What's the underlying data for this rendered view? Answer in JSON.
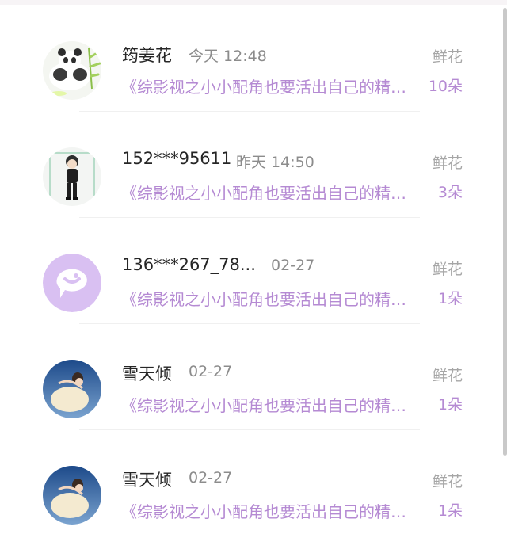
{
  "items": [
    {
      "avatar": "panda-avatar",
      "name": "筠姜花",
      "time": "今天 12:48",
      "book": "《综影视之小小配角也要活出自己的精彩》",
      "gift_type": "鲜花",
      "gift_count": "10朵"
    },
    {
      "avatar": "anime-boy-avatar",
      "name": "152***95611",
      "time": "昨天 14:50",
      "book": "《综影视之小小配角也要活出自己的精彩》",
      "gift_type": "鲜花",
      "gift_count": "3朵"
    },
    {
      "avatar": "default-chat-avatar",
      "name": "136***267_78...",
      "time": "02-27",
      "book": "《综影视之小小配角也要活出自己的精彩》",
      "gift_type": "鲜花",
      "gift_count": "1朵"
    },
    {
      "avatar": "dancer-avatar",
      "name": "雪天倾",
      "time": "02-27",
      "book": "《综影视之小小配角也要活出自己的精彩》",
      "gift_type": "鲜花",
      "gift_count": "1朵"
    },
    {
      "avatar": "dancer-avatar",
      "name": "雪天倾",
      "time": "02-27",
      "book": "《综影视之小小配角也要活出自己的精彩》",
      "gift_type": "鲜花",
      "gift_count": "1朵"
    }
  ],
  "colors": {
    "accent_purple": "#b58ad3",
    "avatar_purple": "#d9c0f2",
    "name_text": "#262626",
    "muted_text": "#8c8c8c"
  }
}
